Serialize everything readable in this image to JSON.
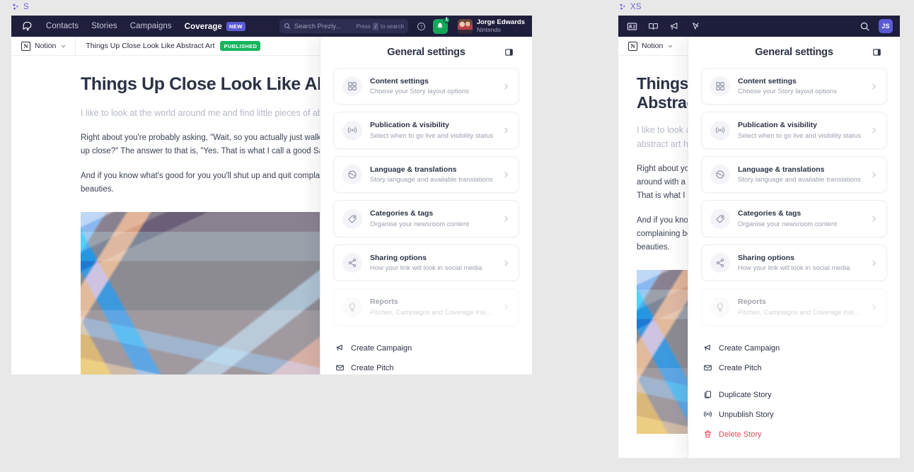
{
  "viewports": [
    {
      "label": "S"
    },
    {
      "label": "XS"
    }
  ],
  "topnav": {
    "brand_icon": "prezly-logo-icon",
    "links": [
      {
        "label": "Contacts",
        "active": false
      },
      {
        "label": "Stories",
        "active": false
      },
      {
        "label": "Campaigns",
        "active": false
      },
      {
        "label": "Coverage",
        "active": true,
        "badge": "NEW"
      }
    ],
    "search": {
      "placeholder": "Search Prezly...",
      "hint_prefix": "Press",
      "hint_key": "/",
      "hint_suffix": "to search",
      "icon": "search-icon"
    },
    "help_icon": "question-circle-icon",
    "notifications": {
      "icon": "bell-icon",
      "count": "1",
      "color": "#14a85a"
    },
    "user": {
      "name": "Jorge Edwards",
      "org": "Nintendo"
    },
    "xs_icons": [
      {
        "name": "contacts-card-icon"
      },
      {
        "name": "stories-book-icon"
      },
      {
        "name": "campaigns-megaphone-icon"
      },
      {
        "name": "coverage-pin-icon"
      }
    ],
    "xs_search_icon": "search-icon",
    "xs_avatar_initials": "JS",
    "xs_avatar_color": "#5b5bd6"
  },
  "breadcrumb": {
    "site_name": "Notion",
    "site_glyph": "N",
    "chevron": "chevron-down-icon",
    "story_title": "Things Up Close Look Like Abstract Art",
    "status": "PUBLISHED",
    "status_color": "#15b65e"
  },
  "article": {
    "title": "Things Up Close Look Like Abstract Art",
    "title_xs": "Things Up Close Look Like Abstract Art",
    "lede": "I like to look at the world around me and find little pieces of abstract art hiding everywhere.",
    "lede_xs": "I like to look at the world around me and find little pieces of abstract art hiding everywhere.",
    "paragraphs": [
      "Right about you're probably asking, \"Wait, so you actually just walk around with a camera looking for things to photograph up close?\" The answer to that is, \"Yes. That is what I call a good Saturday morning.\"",
      "And if you know what's good for you you'll shut up and quit complaining because I intend to keep on shooting these little beauties."
    ],
    "paragraphs_xs": [
      "Right about you're probably asking, \"Wait, so you actually just walk around with a camera looking for things to photograph up close?\" That is what I call a good Saturday morning.\"",
      "And if you know what's good for you you'll shut up and quit complaining because I intend to keep on shooting these little beauties."
    ],
    "photo_alt": "crumpled-iridescent-foil-photo"
  },
  "settings": {
    "title": "General settings",
    "toggle_icon": "panel-collapse-icon",
    "cards": [
      {
        "icon": "grid-squares-icon",
        "title": "Content settings",
        "sub": "Choose your Story layout options",
        "disabled": false
      },
      {
        "icon": "broadcast-antenna-icon",
        "title": "Publication & visibility",
        "sub": "Select when to go live and visibility status",
        "disabled": false
      },
      {
        "icon": "globe-icon",
        "title": "Language & translations",
        "sub": "Story language and available translations",
        "disabled": false
      },
      {
        "icon": "tag-icon",
        "title": "Categories & tags",
        "sub": "Organise your newsroom content",
        "disabled": false
      },
      {
        "icon": "share-nodes-icon",
        "title": "Sharing options",
        "sub": "How your link will look in social media",
        "disabled": false
      },
      {
        "icon": "lightbulb-icon",
        "title": "Reports",
        "sub": "Pitches, Campaigns and Coverage insights",
        "disabled": true
      }
    ],
    "actions_primary": [
      {
        "icon": "megaphone-icon",
        "label": "Create Campaign",
        "danger": false
      },
      {
        "icon": "envelope-icon",
        "label": "Create Pitch",
        "danger": false
      }
    ],
    "actions_secondary": [
      {
        "icon": "duplicate-icon",
        "label": "Duplicate Story",
        "danger": false
      },
      {
        "icon": "broadcast-antenna-icon",
        "label": "Unpublish Story",
        "danger": false
      },
      {
        "icon": "trash-icon",
        "label": "Delete Story",
        "danger": true
      }
    ],
    "danger_color": "#f2445c"
  }
}
